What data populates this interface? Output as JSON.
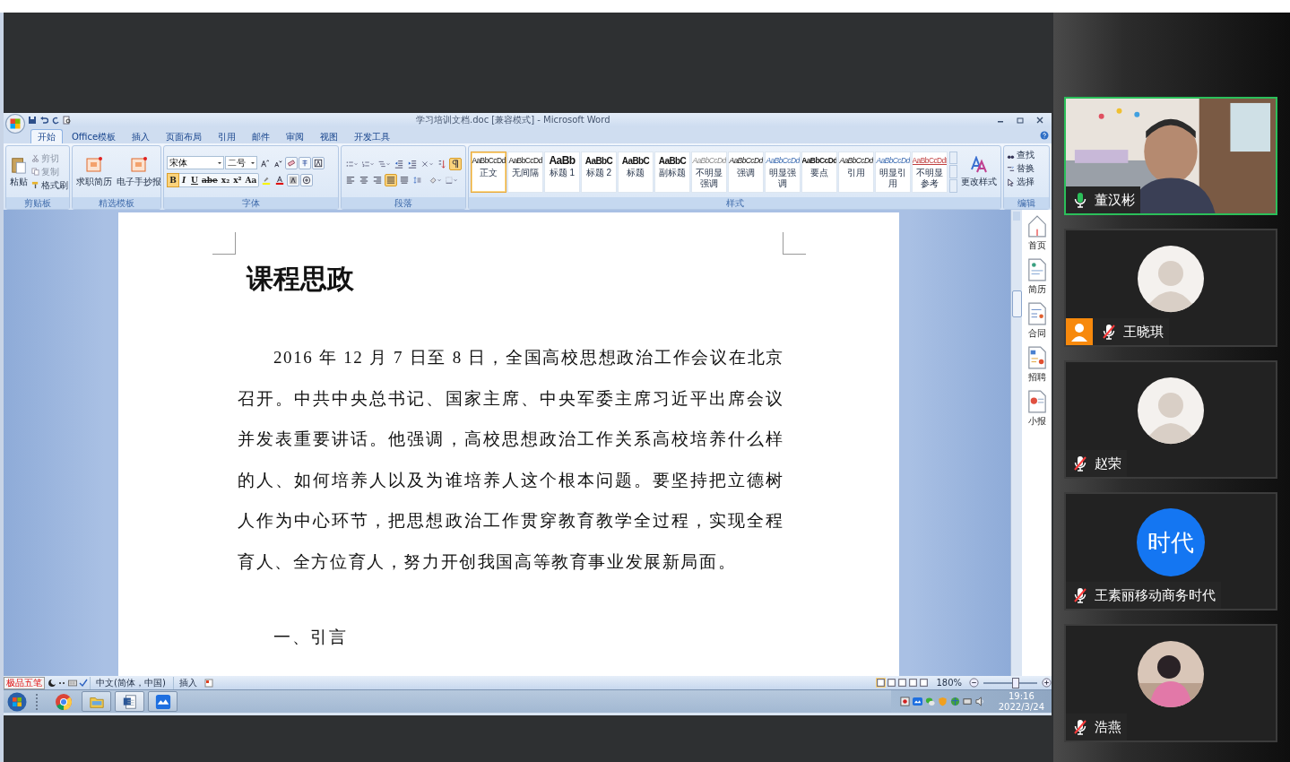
{
  "word": {
    "title": "学习培训文档.doc [兼容模式] - Microsoft Word",
    "tabs": [
      {
        "label": "开始",
        "selected": true
      },
      {
        "label": "Office模板",
        "selected": false
      },
      {
        "label": "插入",
        "selected": false
      },
      {
        "label": "页面布局",
        "selected": false
      },
      {
        "label": "引用",
        "selected": false
      },
      {
        "label": "邮件",
        "selected": false
      },
      {
        "label": "审阅",
        "selected": false
      },
      {
        "label": "视图",
        "selected": false
      },
      {
        "label": "开发工具",
        "selected": false
      }
    ],
    "clipboard": {
      "label": "剪贴板",
      "paste": "粘贴",
      "cut": "剪切",
      "copy": "复制",
      "format_painter": "格式刷"
    },
    "templates": {
      "label": "精选模板",
      "items": [
        "求职简历",
        "电子手抄报"
      ]
    },
    "font": {
      "label": "字体",
      "family": "宋体",
      "size": "二号",
      "tools": [
        {
          "glyph": "B",
          "kind": "bold",
          "selected": true
        },
        {
          "glyph": "I",
          "kind": "italic",
          "selected": false
        },
        {
          "glyph": "U",
          "kind": "underline",
          "selected": false
        },
        {
          "glyph": "abe",
          "kind": "strike",
          "selected": false
        },
        {
          "glyph": "x₂",
          "kind": "sub",
          "selected": false
        },
        {
          "glyph": "x²",
          "kind": "sup",
          "selected": false
        },
        {
          "glyph": "Aa",
          "kind": "case",
          "selected": false
        }
      ]
    },
    "paragraph": {
      "label": "段落",
      "alignments": [
        {
          "kind": "left",
          "selected": false
        },
        {
          "kind": "center",
          "selected": false
        },
        {
          "kind": "right",
          "selected": false
        },
        {
          "kind": "justify",
          "selected": true
        },
        {
          "kind": "distributed",
          "selected": false
        }
      ],
      "show_marks": true
    },
    "styles": {
      "label": "样式",
      "change": "更改样式",
      "items": [
        {
          "preview": "AaBbCcDd",
          "label": "正文",
          "kind": "normal",
          "selected": true
        },
        {
          "preview": "AaBbCcDd",
          "label": "无间隔",
          "kind": "normal",
          "selected": false
        },
        {
          "preview": "AaBb",
          "label": "标题 1",
          "kind": "h1",
          "selected": false
        },
        {
          "preview": "AaBbC",
          "label": "标题 2",
          "kind": "h2",
          "selected": false
        },
        {
          "preview": "AaBbC",
          "label": "标题",
          "kind": "h2",
          "selected": false
        },
        {
          "preview": "AaBbC",
          "label": "副标题",
          "kind": "h2",
          "selected": false
        },
        {
          "preview": "AaBbCcDd",
          "label": "不明显强调",
          "kind": "subtle",
          "selected": false
        },
        {
          "preview": "AaBbCcDd",
          "label": "强调",
          "kind": "emphasis",
          "selected": false
        },
        {
          "preview": "AaBbCcDd",
          "label": "明显强调",
          "kind": "intense",
          "selected": false
        },
        {
          "preview": "AaBbCcDd",
          "label": "要点",
          "kind": "strong",
          "selected": false
        },
        {
          "preview": "AaBbCcDd",
          "label": "引用",
          "kind": "emphasis",
          "selected": false
        },
        {
          "preview": "AaBbCcDd",
          "label": "明显引用",
          "kind": "intense",
          "selected": false
        },
        {
          "preview": "AaBbCcDdI",
          "label": "不明显参考",
          "kind": "reference",
          "selected": false
        }
      ]
    },
    "editing": {
      "label": "编辑",
      "items": [
        "查找",
        "替换",
        "选择"
      ]
    }
  },
  "document": {
    "heading": "课程思政",
    "paragraphs": [
      {
        "kind": "body",
        "text": "2016 年 12 月 7 日至 8 日，全国高校思想政治工作会议在北京召开。中共中央总书记、国家主席、中央军委主席习近平出席会议并发表重要讲话。他强调，高校思想政治工作关系高校培养什么样的人、如何培养人以及为谁培养人这个根本问题。要坚持把立德树人作为中心环节，把思想政治工作贯穿教育教学全过程，实现全程育人、全方位育人，努力开创我国高等教育事业发展新局面。"
      },
      {
        "kind": "section",
        "text": "一、引言"
      }
    ]
  },
  "side_panel": [
    {
      "label": "首页",
      "kind": "home"
    },
    {
      "label": "简历",
      "kind": "resume"
    },
    {
      "label": "合同",
      "kind": "contract"
    },
    {
      "label": "招聘",
      "kind": "hiring"
    },
    {
      "label": "小报",
      "kind": "paper"
    }
  ],
  "status_bar": {
    "ime": "极品五笔",
    "language": "中文(简体，中国)",
    "mode": "插入",
    "zoom": "180%",
    "zoom_slider": {
      "level": 0.62
    }
  },
  "taskbar": {
    "time": "19:16",
    "date": "2022/3/24",
    "apps": [
      {
        "kind": "chrome"
      },
      {
        "kind": "explorer"
      },
      {
        "kind": "word"
      },
      {
        "kind": "meeting"
      }
    ]
  },
  "participants": [
    {
      "name": "董汉彬",
      "kind": "video",
      "muted": false,
      "speaking": true,
      "host": false
    },
    {
      "name": "王晓琪",
      "kind": "avatar",
      "muted": true,
      "speaking": false,
      "host": true
    },
    {
      "name": "赵荣",
      "kind": "avatar",
      "muted": true,
      "speaking": false,
      "host": false
    },
    {
      "name": "王素丽移动商务时代",
      "kind": "initials",
      "initials": "时代",
      "muted": true,
      "speaking": false,
      "host": false
    },
    {
      "name": "浩燕",
      "muted": true,
      "speaking": false,
      "host": false
    }
  ]
}
